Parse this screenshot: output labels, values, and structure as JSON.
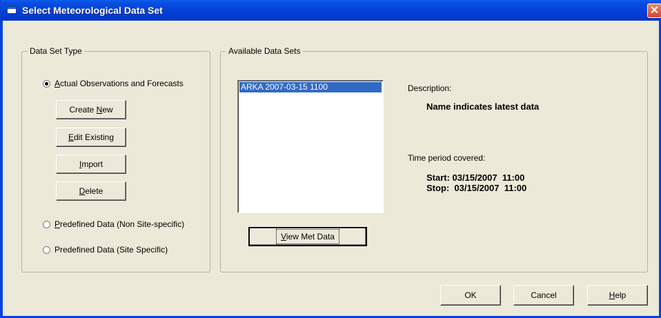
{
  "window": {
    "title": "Select Meteorological Data Set",
    "close_symbol": "✕"
  },
  "data_set_type": {
    "legend": "Data Set Type",
    "options": [
      {
        "label_first": "A",
        "label_rest": "ctual Observations and Forecasts",
        "checked": true
      },
      {
        "label_first": "P",
        "label_rest": "redefined Data (Non Site-specific)",
        "checked": false
      },
      {
        "label_first": "",
        "label_rest": "Predefined Data (Site Specific)",
        "checked": false
      }
    ],
    "buttons": {
      "create_new": {
        "pre": "Create ",
        "ul": "N",
        "post": "ew"
      },
      "edit_existing": {
        "pre": "",
        "ul": "E",
        "post": "dit Existing"
      },
      "import": {
        "pre": "",
        "ul": "I",
        "post": "mport"
      },
      "delete": {
        "pre": "",
        "ul": "D",
        "post": "elete"
      }
    }
  },
  "available_data_sets": {
    "legend": "Available Data Sets",
    "items": [
      "ARKA 2007-03-15 1100"
    ],
    "selected_index": 0,
    "view_button": {
      "pre": "",
      "ul": "V",
      "post": "iew Met Data"
    }
  },
  "details": {
    "description_label": "Description:",
    "description_value": "Name indicates latest data",
    "time_period_label": "Time period covered:",
    "start_text": "Start: 03/15/2007  11:00",
    "stop_text": "Stop:  03/15/2007  11:00"
  },
  "footer": {
    "ok_label": "OK",
    "cancel_label": "Cancel",
    "help": {
      "pre": "",
      "ul": "H",
      "post": "elp"
    }
  }
}
